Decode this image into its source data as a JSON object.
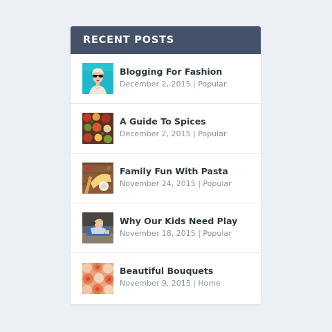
{
  "widget": {
    "title": "RECENT POSTS",
    "header_color": "#44536a"
  },
  "posts": [
    {
      "title": "Blogging For Fashion",
      "date": "December 2, 2015",
      "category": "Popular",
      "thumbnail": "woman-sunglasses-image",
      "meta": "December 2, 2015 | Popular"
    },
    {
      "title": "A Guide To Spices",
      "date": "December 2, 2015",
      "category": "Popular",
      "thumbnail": "spices-image",
      "meta": "December 2, 2015 | Popular"
    },
    {
      "title": "Family Fun With Pasta",
      "date": "November 24, 2015",
      "category": "Popular",
      "thumbnail": "pasta-image",
      "meta": "November 24, 2015 | Popular"
    },
    {
      "title": "Why Our Kids Need Play",
      "date": "November 18, 2015",
      "category": "Popular",
      "thumbnail": "child-playing-image",
      "meta": "November 18, 2015 | Popular"
    },
    {
      "title": "Beautiful Bouquets",
      "date": "November 9, 2015",
      "category": "Home",
      "thumbnail": "roses-image",
      "meta": "November 9, 2015 | Home"
    }
  ]
}
